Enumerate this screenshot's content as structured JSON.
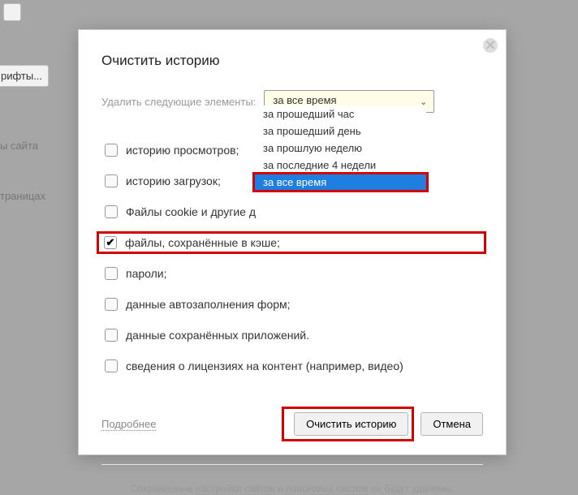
{
  "background": {
    "fonts_button": "рифты...",
    "site_text": "ы сайта",
    "pages_text": "траницах"
  },
  "dialog": {
    "title": "Очистить историю",
    "prompt": "Удалить следующие элементы:",
    "select_value": "за все время",
    "dropdown": [
      "за прошедший час",
      "за прошедший день",
      "за прошлую неделю",
      "за последние 4 недели",
      "за все время"
    ],
    "items": [
      {
        "label": "историю просмотров;",
        "checked": false
      },
      {
        "label": "историю загрузок;",
        "checked": false
      },
      {
        "label": "Файлы cookie и другие д",
        "checked": false
      },
      {
        "label": "файлы, сохранённые в кэше;",
        "checked": true
      },
      {
        "label": "пароли;",
        "checked": false
      },
      {
        "label": "данные автозаполнения форм;",
        "checked": false
      },
      {
        "label": "данные сохранённых приложений.",
        "checked": false
      },
      {
        "label": "сведения о лицензиях на контент (например, видео)",
        "checked": false
      }
    ],
    "more_label": "Подробнее",
    "clear_label": "Очистить историю",
    "cancel_label": "Отмена",
    "footer_pre": "Сохраненные ",
    "footer_link1": "настройки сайтов",
    "footer_mid": " и ",
    "footer_link2": "поисковых систем",
    "footer_post": " не будут удалены."
  }
}
